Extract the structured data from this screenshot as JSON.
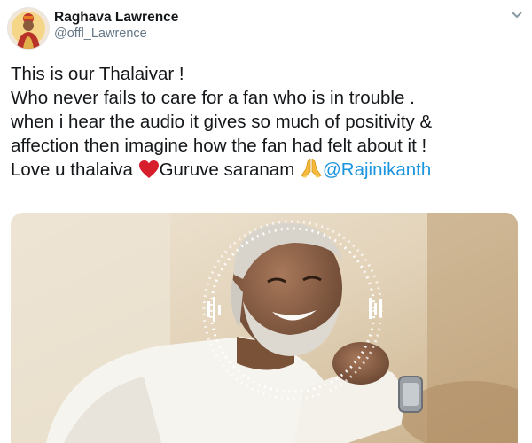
{
  "user": {
    "display_name": "Raghava Lawrence",
    "handle": "@offl_Lawrence"
  },
  "tweet": {
    "line1": "This is our Thalaivar !",
    "line2": "Who never fails to care for a fan who is in trouble .",
    "line3": "when i hear the audio it gives so much of positivity &",
    "line4": "affection then imagine how the fan had felt about it !",
    "line5_part1": "Love u thalaiva ",
    "line5_part2": "Guruve saranam ",
    "mention": "@Rajinikanth"
  },
  "icons": {
    "heart": "red-heart-icon",
    "hands": "folded-hands-icon",
    "menu": "chevron-down-icon"
  },
  "colors": {
    "mention": "#1b95e0",
    "handle": "#657786",
    "heart": "#d61e2d"
  }
}
